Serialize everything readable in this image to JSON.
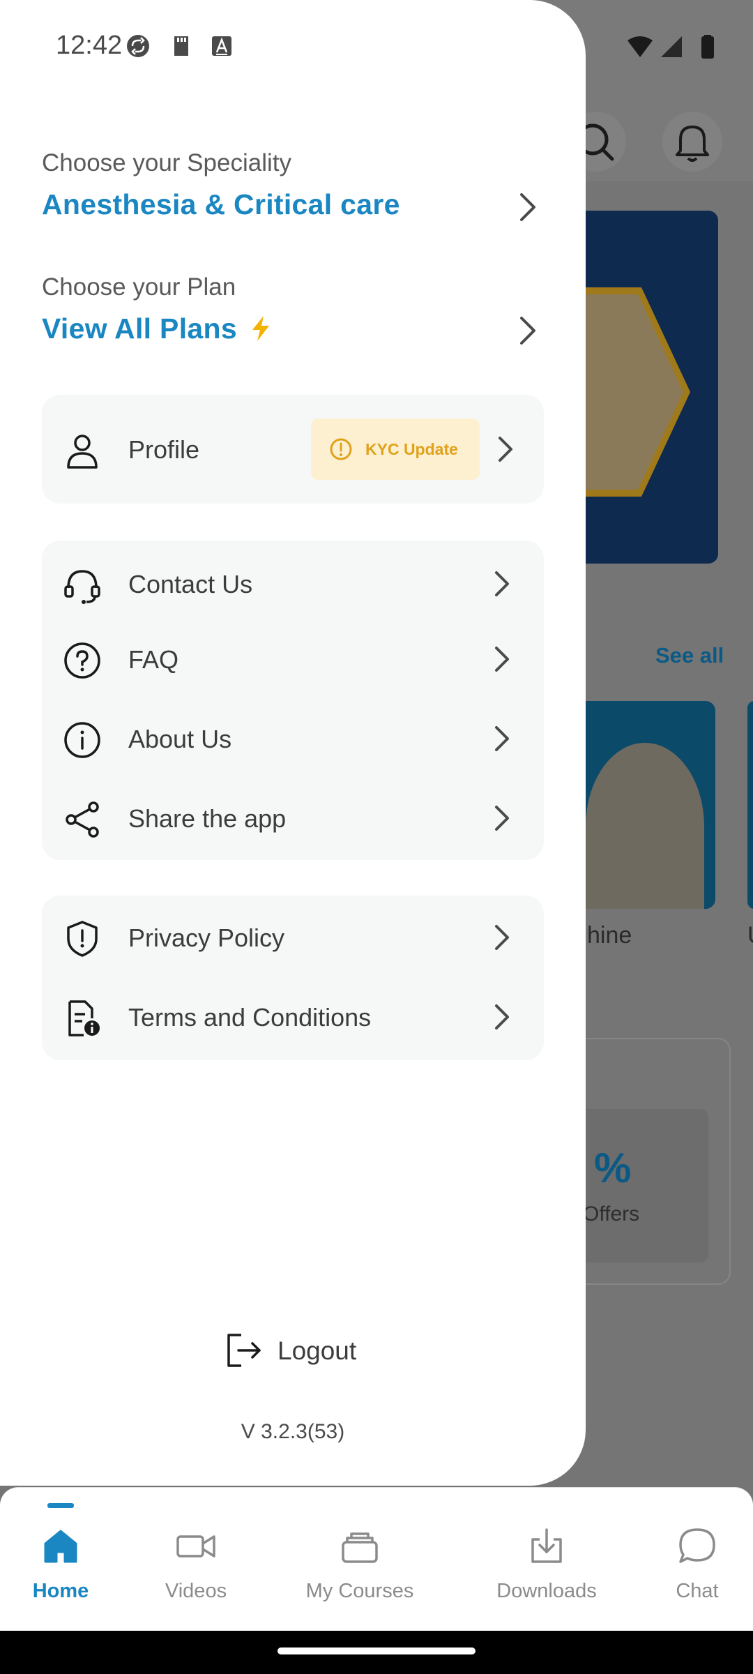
{
  "status_bar": {
    "time": "12:42"
  },
  "background": {
    "see_all": "See all",
    "card_caption_partial": "hine",
    "card_caption_partial2": "U",
    "offers_label": "Offers",
    "offers_symbol": "%"
  },
  "drawer": {
    "speciality": {
      "label": "Choose your Speciality",
      "value": "Anesthesia & Critical care"
    },
    "plan": {
      "label": "Choose your Plan",
      "value": "View All Plans"
    },
    "profile": {
      "label": "Profile",
      "kyc_badge": "KYC Update"
    },
    "support_items": [
      {
        "label": "Contact Us",
        "icon": "headset-icon"
      },
      {
        "label": "FAQ",
        "icon": "question-icon"
      },
      {
        "label": "About Us",
        "icon": "info-icon"
      },
      {
        "label": "Share the app",
        "icon": "share-icon"
      }
    ],
    "legal_items": [
      {
        "label": "Privacy Policy",
        "icon": "shield-icon"
      },
      {
        "label": "Terms and Conditions",
        "icon": "document-info-icon"
      }
    ],
    "logout": "Logout",
    "version": "V 3.2.3(53)"
  },
  "bottom_nav": {
    "items": [
      {
        "label": "Home",
        "icon": "home-icon",
        "active": true
      },
      {
        "label": "Videos",
        "icon": "video-icon",
        "active": false
      },
      {
        "label": "My Courses",
        "icon": "courses-icon",
        "active": false
      },
      {
        "label": "Downloads",
        "icon": "download-icon",
        "active": false
      },
      {
        "label": "Chat",
        "icon": "chat-icon",
        "active": false
      }
    ]
  },
  "colors": {
    "accent": "#1a86c2",
    "kyc_bg": "#fdf0d0",
    "kyc_text": "#e0a21c",
    "bolt": "#f2b300"
  }
}
